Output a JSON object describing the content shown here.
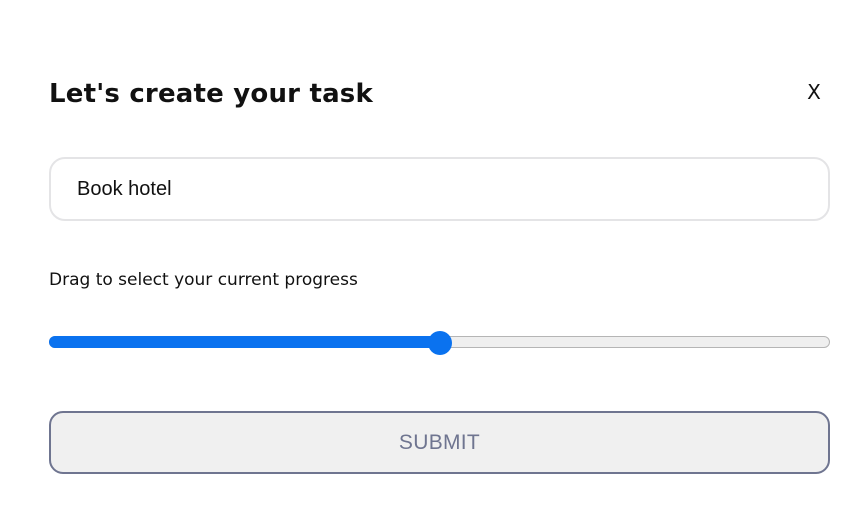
{
  "modal": {
    "title": "Let's create your task",
    "close_label": "X"
  },
  "task_input": {
    "value": "Book hotel",
    "placeholder": ""
  },
  "progress": {
    "label": "Drag to select your current progress",
    "value_percent": 50
  },
  "submit": {
    "label": "SUBMIT"
  },
  "colors": {
    "accent": "#0a72ef",
    "submit_border": "#6f7590",
    "submit_background": "#f0f0f0",
    "input_border": "#e4e4e6"
  }
}
